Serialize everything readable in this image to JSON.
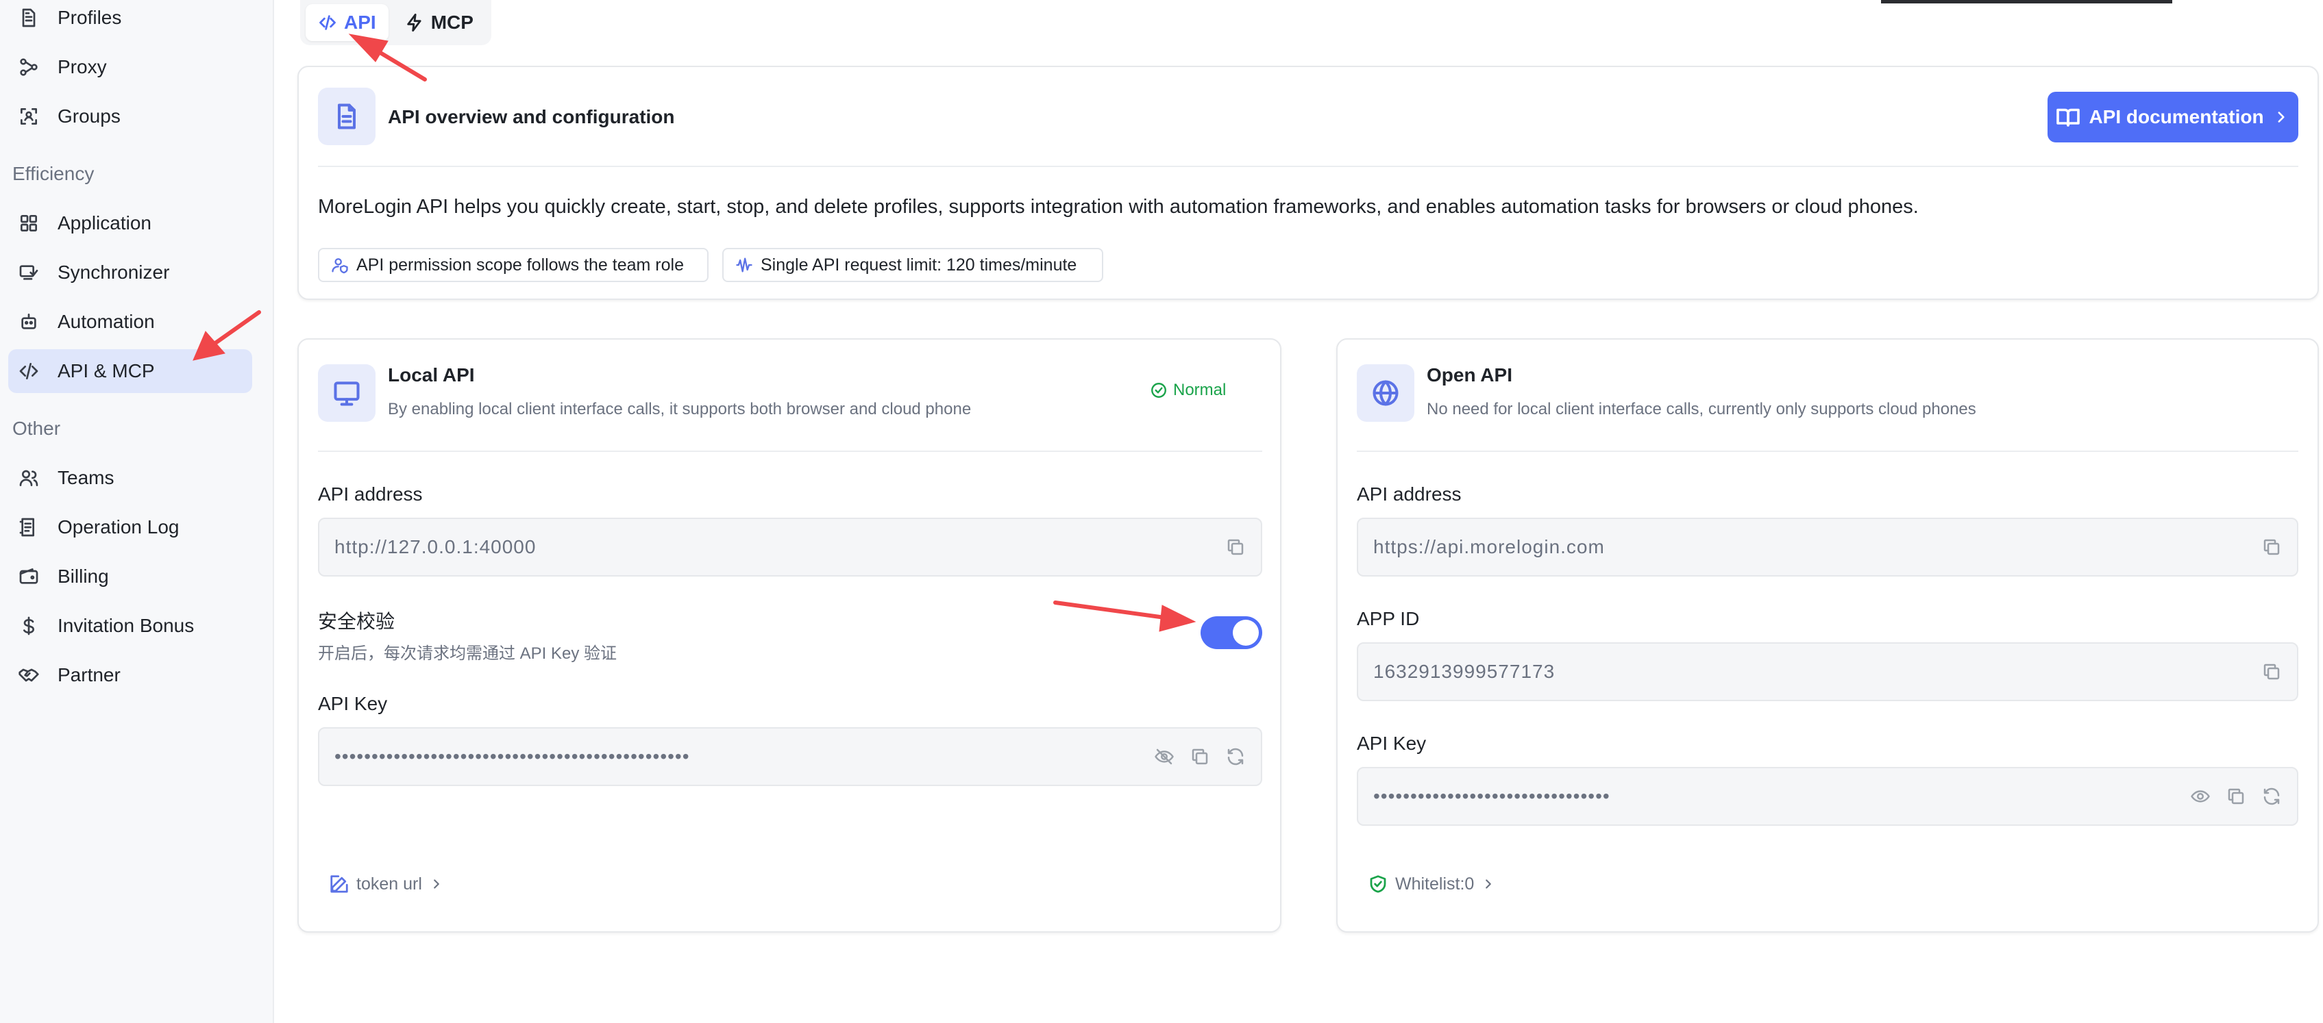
{
  "sidebar": {
    "items_top": [
      {
        "label": "Profiles",
        "icon": "file-icon"
      },
      {
        "label": "Proxy",
        "icon": "proxy-icon"
      },
      {
        "label": "Groups",
        "icon": "groups-icon"
      }
    ],
    "section_efficiency": "Efficiency",
    "items_efficiency": [
      {
        "label": "Application",
        "icon": "grid-icon"
      },
      {
        "label": "Synchronizer",
        "icon": "sync-icon"
      },
      {
        "label": "Automation",
        "icon": "robot-icon"
      },
      {
        "label": "API & MCP",
        "icon": "code-icon",
        "active": true
      }
    ],
    "section_other": "Other",
    "items_other": [
      {
        "label": "Teams",
        "icon": "users-icon"
      },
      {
        "label": "Operation Log",
        "icon": "log-icon"
      },
      {
        "label": "Billing",
        "icon": "wallet-icon"
      },
      {
        "label": "Invitation Bonus",
        "icon": "dollar-icon"
      },
      {
        "label": "Partner",
        "icon": "handshake-icon"
      }
    ]
  },
  "tabs": {
    "api": "API",
    "mcp": "MCP",
    "active": "API"
  },
  "overview": {
    "title": "API overview and configuration",
    "doc_button": "API documentation",
    "description": "MoreLogin API helps you quickly create, start, stop, and delete profiles, supports integration with automation frameworks, and enables automation tasks for browsers or cloud phones.",
    "chip_permission": "API permission scope follows the team role",
    "chip_limit": "Single API request limit: 120 times/minute"
  },
  "local_api": {
    "title": "Local API",
    "subtitle": "By enabling local client interface calls, it supports both browser and cloud phone",
    "status": "Normal",
    "address_label": "API address",
    "address_value": "http://127.0.0.1:40000",
    "security_label": "安全校验",
    "security_desc": "开启后，每次请求均需通过 API Key 验证",
    "security_enabled": true,
    "key_label": "API Key",
    "key_value": "••••••••••••••••••••••••••••••••••••••••••••••••",
    "token_link": "token url"
  },
  "open_api": {
    "title": "Open API",
    "subtitle": "No need for local client interface calls, currently only supports cloud phones",
    "address_label": "API address",
    "address_value": "https://api.morelogin.com",
    "appid_label": "APP ID",
    "appid_value": "1632913999577173",
    "key_label": "API Key",
    "key_value": "••••••••••••••••••••••••••••••••",
    "whitelist_link": "Whitelist:0"
  },
  "colors": {
    "accent": "#4f6ef7",
    "success": "#1aa34a",
    "annotation_arrow": "#f0474a",
    "active_nav_bg": "#dfe6fb"
  }
}
